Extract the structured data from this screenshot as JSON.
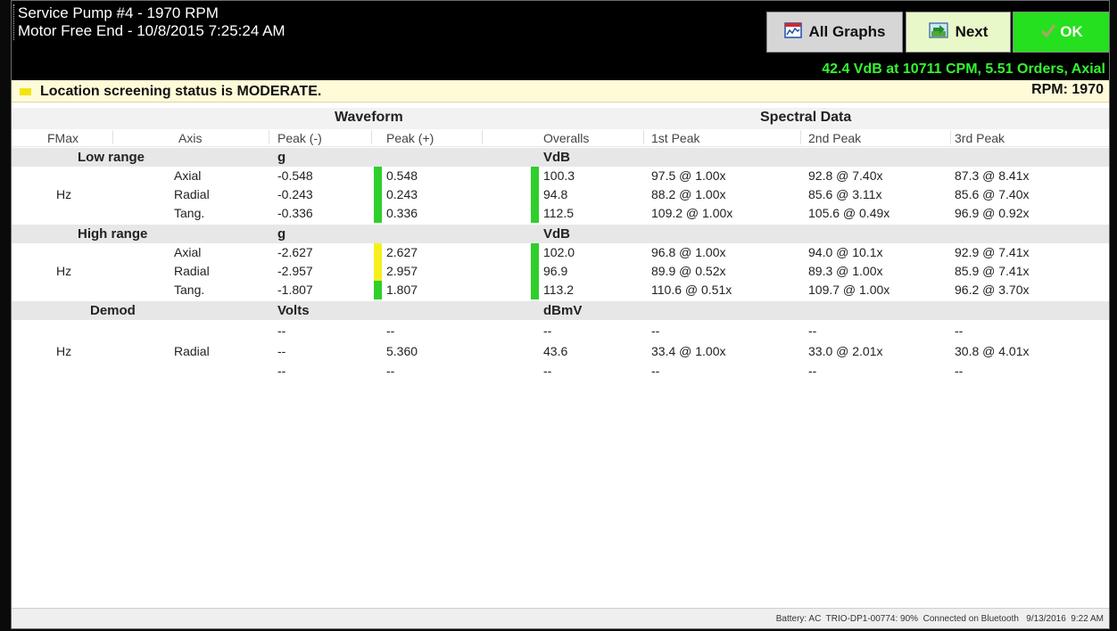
{
  "header": {
    "line1": "Service Pump #4 - 1970 RPM",
    "line2": "Motor Free End - 10/8/2015 7:25:24 AM",
    "buttons": {
      "all_graphs": "All Graphs",
      "next": "Next",
      "ok": "OK"
    },
    "status": "42.4 VdB at 10711 CPM, 5.51 Orders, Axial"
  },
  "banner": {
    "text": "Location screening status is MODERATE.",
    "rpm": "RPM: 1970",
    "status_color": "#f2e40f"
  },
  "groups": {
    "waveform": "Waveform",
    "spectral": "Spectral Data"
  },
  "columns": [
    "FMax",
    "Axis",
    "Peak (-)",
    "Peak (+)",
    "Overalls",
    "1st Peak",
    "2nd Peak",
    "3rd Peak"
  ],
  "sections": [
    {
      "name": "Low range",
      "unit_waveform": "g",
      "unit_spectral": "VdB",
      "fmax": "Hz",
      "rows": [
        {
          "axis": "Axial",
          "peak_neg": "-0.548",
          "peak_pos": "0.548",
          "overall": "100.3",
          "p1": "97.5 @ 1.00x",
          "p2": "92.8 @ 7.40x",
          "p3": "87.3 @ 8.41x"
        },
        {
          "axis": "Radial",
          "peak_neg": "-0.243",
          "peak_pos": "0.243",
          "overall": "94.8",
          "p1": "88.2 @ 1.00x",
          "p2": "85.6 @ 3.11x",
          "p3": "85.6 @ 7.40x"
        },
        {
          "axis": "Tang.",
          "peak_neg": "-0.336",
          "peak_pos": "0.336",
          "overall": "112.5",
          "p1": "109.2 @ 1.00x",
          "p2": "105.6 @ 0.49x",
          "p3": "96.9 @ 0.92x"
        }
      ]
    },
    {
      "name": "High range",
      "unit_waveform": "g",
      "unit_spectral": "VdB",
      "fmax": "Hz",
      "rows": [
        {
          "axis": "Axial",
          "peak_neg": "-2.627",
          "peak_pos": "2.627",
          "overall": "102.0",
          "p1": "96.8 @ 1.00x",
          "p2": "94.0 @ 10.1x",
          "p3": "92.9 @ 7.41x"
        },
        {
          "axis": "Radial",
          "peak_neg": "-2.957",
          "peak_pos": "2.957",
          "overall": "96.9",
          "p1": "89.9 @ 0.52x",
          "p2": "89.3 @ 1.00x",
          "p3": "85.9 @ 7.41x"
        },
        {
          "axis": "Tang.",
          "peak_neg": "-1.807",
          "peak_pos": "1.807",
          "overall": "113.2",
          "p1": "110.6 @ 0.51x",
          "p2": "109.7 @ 1.00x",
          "p3": "96.2 @ 3.70x"
        }
      ]
    },
    {
      "name": "Demod",
      "unit_waveform": "Volts",
      "unit_spectral": "dBmV",
      "fmax": "Hz",
      "rows": [
        {
          "axis": "",
          "peak_neg": "--",
          "peak_pos": "--",
          "overall": "--",
          "p1": "--",
          "p2": "--",
          "p3": "--"
        },
        {
          "axis": "Radial",
          "peak_neg": "--",
          "peak_pos": "5.360",
          "overall": "43.6",
          "p1": "33.4 @ 1.00x",
          "p2": "33.0 @ 2.01x",
          "p3": "30.8 @ 4.01x"
        },
        {
          "axis": "",
          "peak_neg": "--",
          "peak_pos": "--",
          "overall": "--",
          "p1": "--",
          "p2": "--",
          "p3": "--"
        }
      ]
    }
  ],
  "status_colors": {
    "green": "#2fcf2b",
    "yellow": "#f6ef1e"
  },
  "footer": "Battery: AC  TRIO-DP1-00774: 90%  Connected on Bluetooth   9/13/2016  9:22 AM"
}
